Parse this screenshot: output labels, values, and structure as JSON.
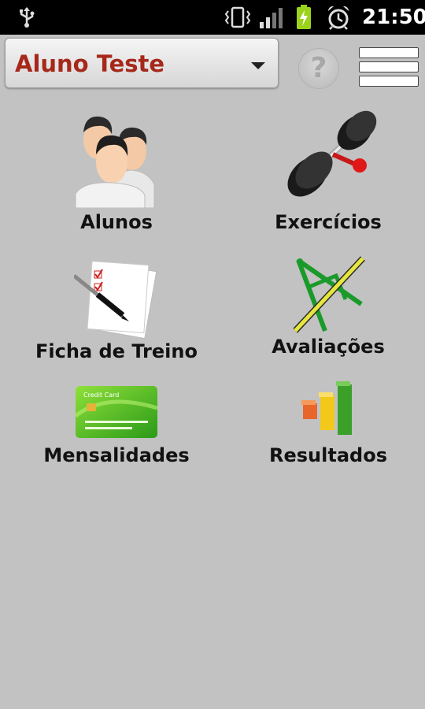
{
  "status_bar": {
    "time": "21:50",
    "icons": [
      "usb-icon",
      "vibrate-icon",
      "signal-icon",
      "battery-charging-icon",
      "alarm-icon"
    ]
  },
  "header": {
    "selected_student": "Aluno Teste",
    "help_label": "?"
  },
  "menu": {
    "items": [
      {
        "label": "Alunos",
        "icon": "students-icon"
      },
      {
        "label": "Exercícios",
        "icon": "dumbbell-icon"
      },
      {
        "label": "Ficha de Treino",
        "icon": "training-sheet-icon"
      },
      {
        "label": "Avaliações",
        "icon": "compass-icon"
      },
      {
        "label": "Mensalidades",
        "icon": "credit-card-icon"
      },
      {
        "label": "Resultados",
        "icon": "bar-chart-icon"
      }
    ],
    "card_text": "Credit Card"
  },
  "colors": {
    "background": "#c2c2c2",
    "student_name": "#a6281a",
    "status_bar": "#000000"
  }
}
